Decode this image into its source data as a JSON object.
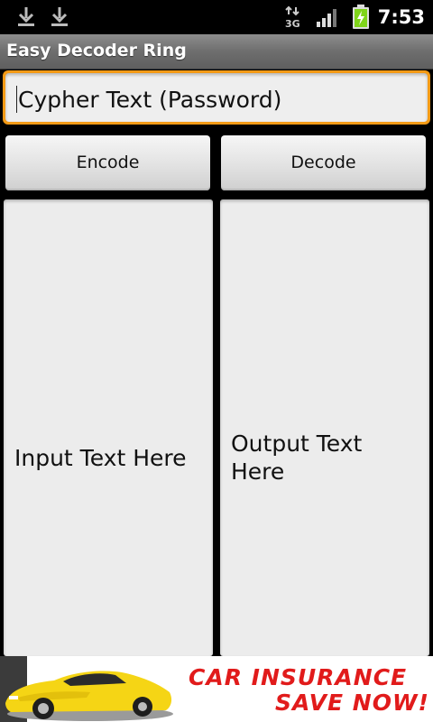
{
  "status_bar": {
    "network": "3G",
    "time": "7:53",
    "icons": [
      "download-icon",
      "download-icon",
      "3g-icon",
      "signal-icon",
      "battery-charging-icon"
    ]
  },
  "app": {
    "title": "Easy Decoder Ring"
  },
  "cypher": {
    "placeholder": "Cypher Text (Password)"
  },
  "buttons": {
    "encode": "Encode",
    "decode": "Decode"
  },
  "input_panel": {
    "placeholder": "Input Text Here"
  },
  "output_panel": {
    "placeholder": "Output Text Here"
  },
  "ad": {
    "line1": "CAR INSURANCE",
    "line2": "SAVE NOW!"
  },
  "colors": {
    "focus_accent": "#f39a16",
    "ad_text": "#e11b1b",
    "car_yellow": "#f5d515"
  }
}
